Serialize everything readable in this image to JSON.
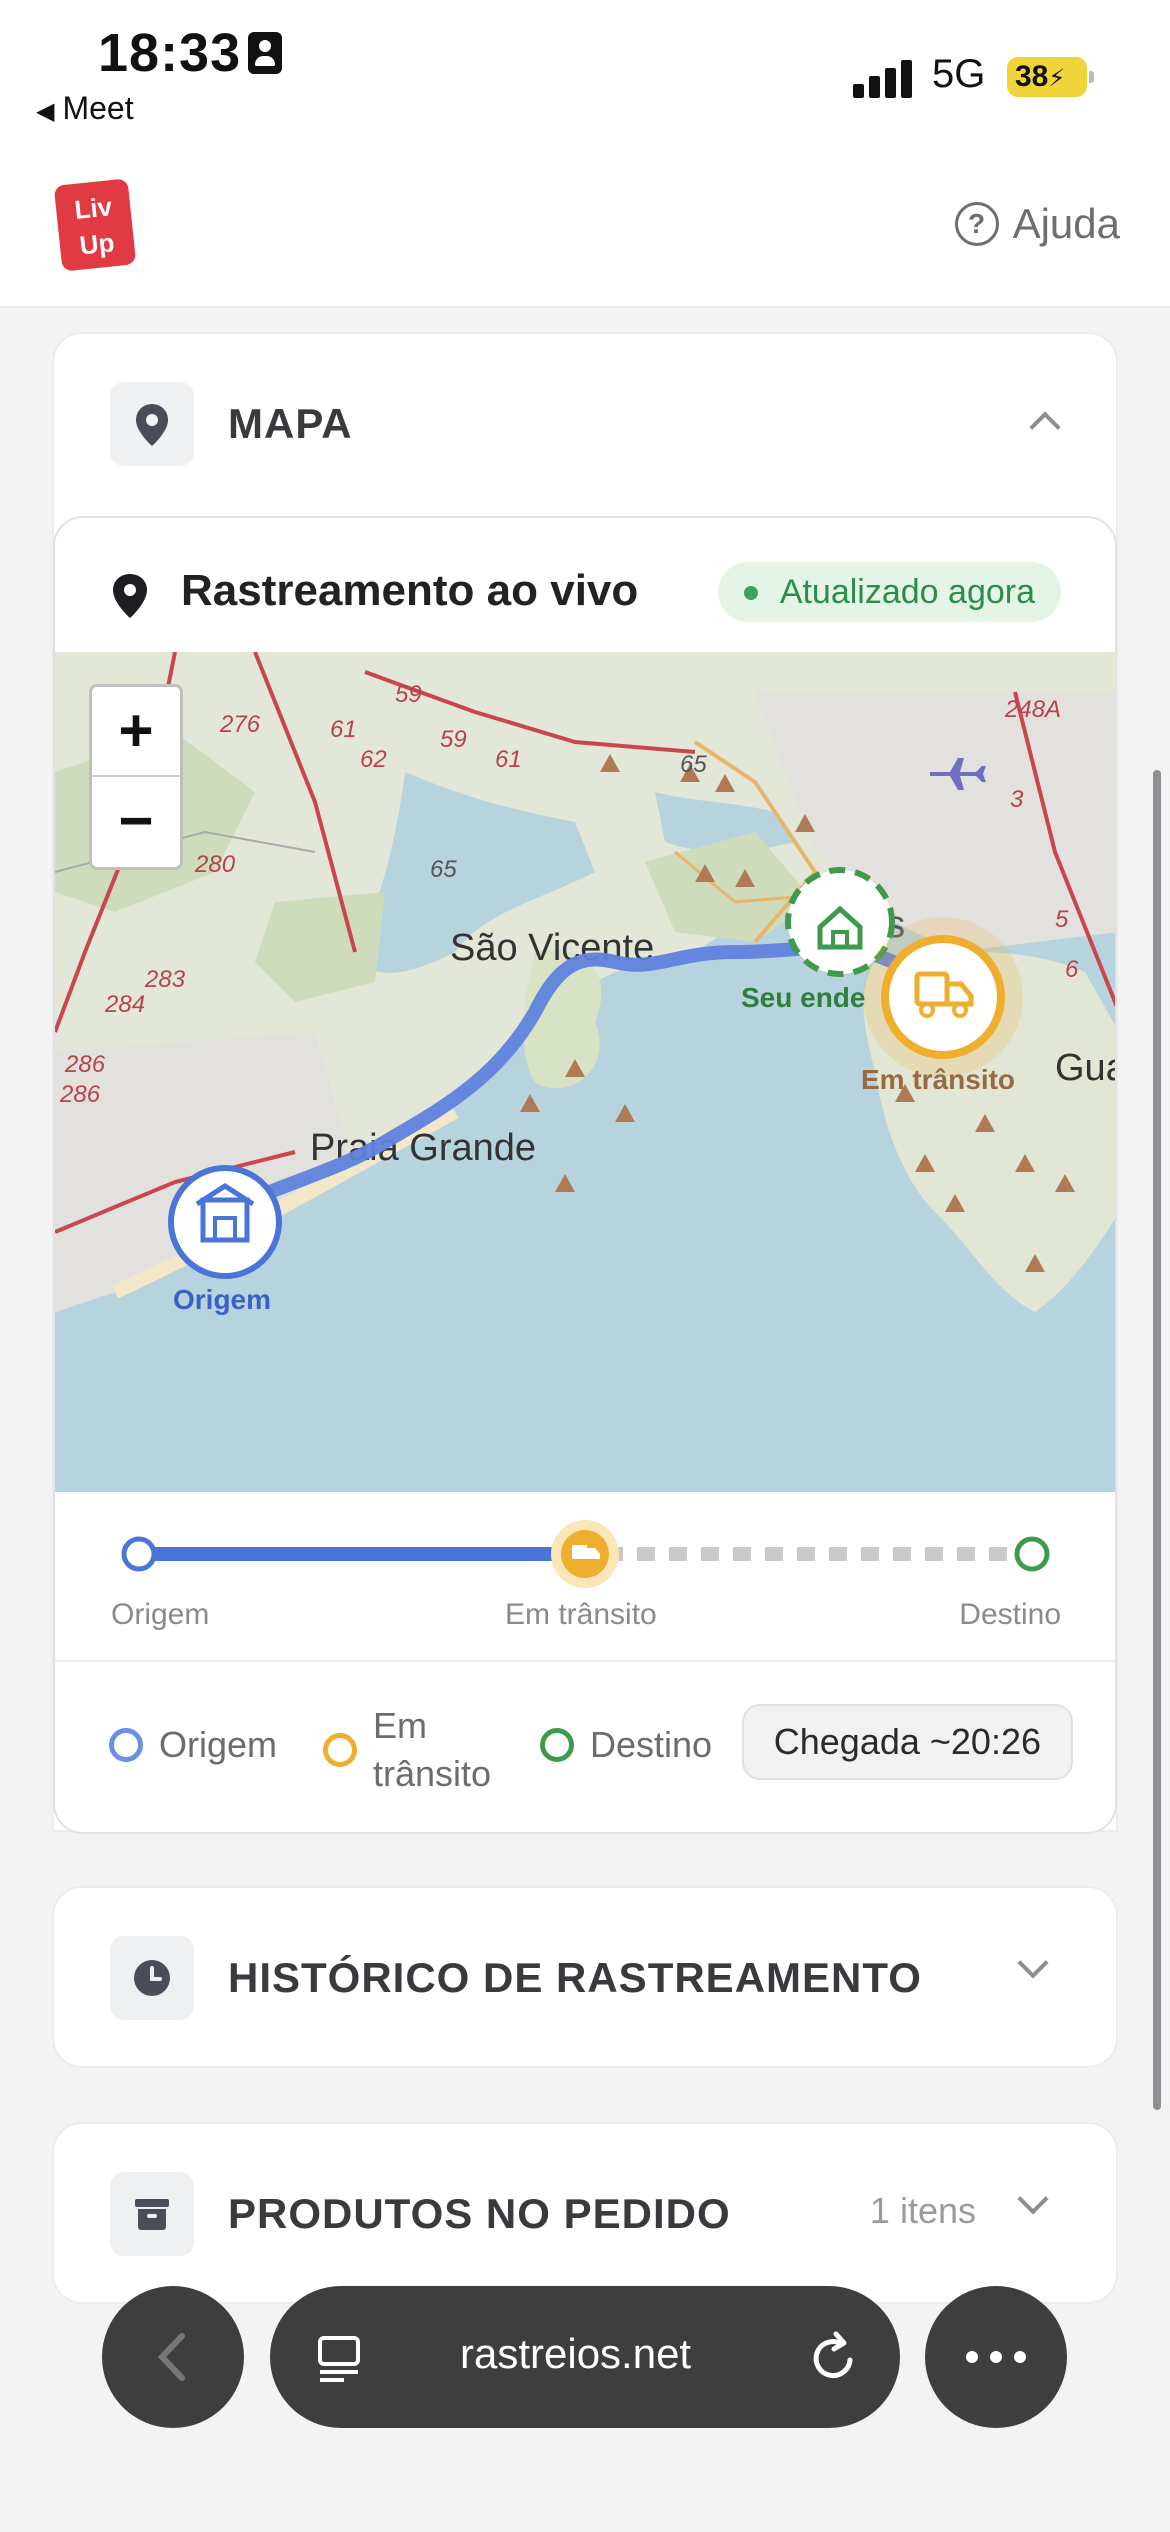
{
  "status_bar": {
    "time": "18:33",
    "back_app": "Meet",
    "network": "5G",
    "battery": "38"
  },
  "header": {
    "logo_text": "Liv Up",
    "help_label": "Ajuda"
  },
  "map_section": {
    "title": "MAPA",
    "live_title": "Rastreamento ao vivo",
    "live_badge": "Atualizado agora",
    "map": {
      "zoom_in": "+",
      "zoom_out": "−",
      "places": [
        "São Vicente",
        "Praia Grande",
        "Gua"
      ],
      "road_numbers": [
        "276",
        "61",
        "62",
        "59",
        "59",
        "61",
        "65",
        "248A",
        "3",
        "280",
        "65",
        "283",
        "284",
        "286",
        "286",
        "5",
        "6"
      ],
      "origin_label": "Origem",
      "destination_label": "Seu ende",
      "transit_label": "Em trânsito"
    },
    "progress": {
      "start": "Origem",
      "middle": "Em trânsito",
      "end": "Destino"
    },
    "legend": {
      "origin": "Origem",
      "transit_line1": "Em",
      "transit_line2": "trânsito",
      "destination": "Destino",
      "eta": "Chegada ~20:26"
    },
    "colors": {
      "origin": "#4a74d8",
      "transit": "#f0ae2e",
      "destination": "#3f9a4e",
      "route": "#5f82dd"
    }
  },
  "history_section": {
    "title": "HISTÓRICO DE RASTREAMENTO"
  },
  "products_section": {
    "title": "PRODUTOS NO PEDIDO",
    "count": "1 itens"
  },
  "browser": {
    "url": "rastreios.net"
  }
}
